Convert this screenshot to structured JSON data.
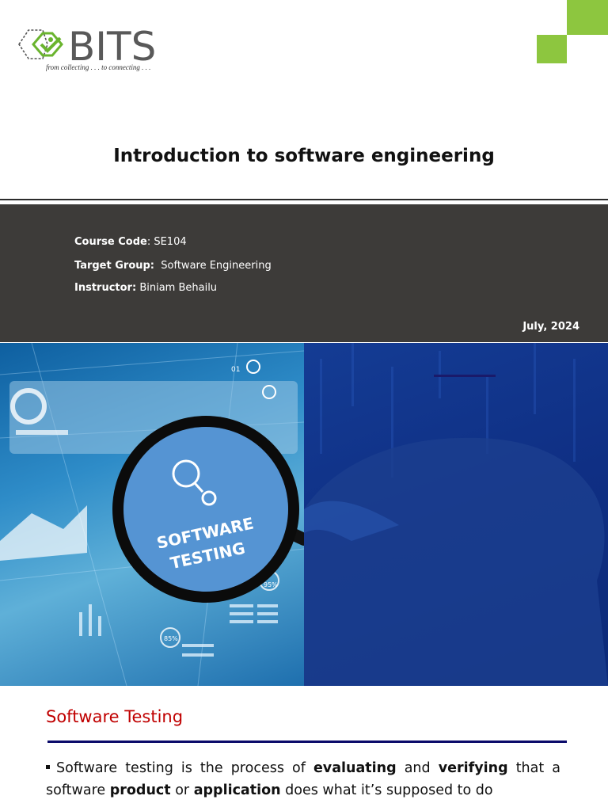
{
  "logo": {
    "wordmark": "BITS",
    "tagline": "from collecting . . . to connecting . . ."
  },
  "title": "Introduction to software engineering",
  "info": {
    "course_code_label": "Course Code",
    "course_code_value": "SE104",
    "target_group_label": "Target Group:",
    "target_group_value": "Software Engineering",
    "instructor_label": "Instructor:",
    "instructor_value": "Biniam Behailu",
    "date": "July, 2024"
  },
  "hero": {
    "lens_line1": "SOFTWARE",
    "lens_line2": "TESTING",
    "pct_a": "95%",
    "pct_b": "85%",
    "pct_c": "01"
  },
  "section": {
    "heading": "Software Testing",
    "p_prefix": "Software testing is the process of",
    "bold1": "evaluating",
    "and1": "and",
    "bold2": "verifying",
    "p_mid": "that a software",
    "bold3": "product",
    "or1": "or",
    "bold4": "application",
    "p_suffix": "does what it’s supposed to do"
  },
  "colors": {
    "accent_green": "#8dc63f",
    "band": "#3d3b39",
    "heading_red": "#c00000",
    "rule_navy": "#0a0a6a"
  }
}
